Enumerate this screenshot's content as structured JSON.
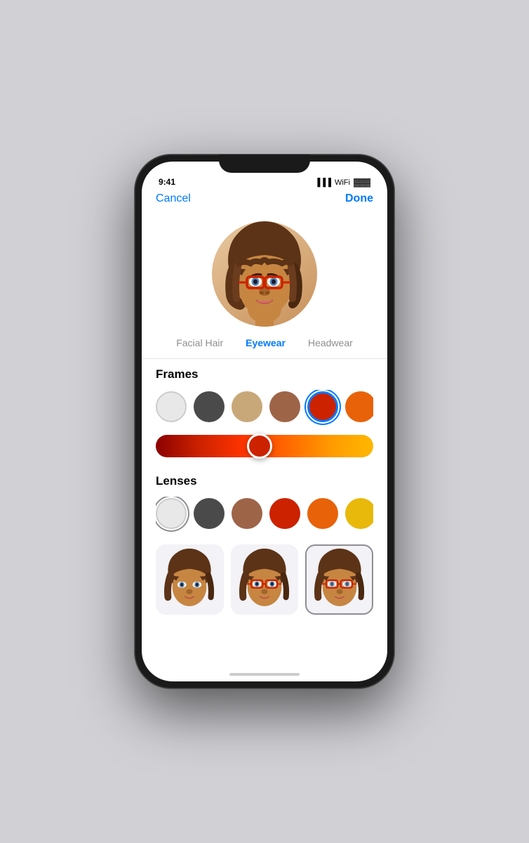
{
  "header": {
    "cancel_label": "Cancel",
    "done_label": "Done"
  },
  "tabs": [
    {
      "id": "facial-hair",
      "label": "Facial Hair",
      "active": false
    },
    {
      "id": "eyewear",
      "label": "Eyewear",
      "active": true
    },
    {
      "id": "headwear",
      "label": "Headwear",
      "active": false
    }
  ],
  "frames_section": {
    "title": "Frames",
    "colors": [
      {
        "id": "white",
        "hex": "#E8E8E8",
        "selected": false
      },
      {
        "id": "dark-gray",
        "hex": "#4A4A4A",
        "selected": false
      },
      {
        "id": "tan",
        "hex": "#C8A878",
        "selected": false
      },
      {
        "id": "brown",
        "hex": "#9E6448",
        "selected": false
      },
      {
        "id": "red",
        "hex": "#CC2200",
        "selected": true
      },
      {
        "id": "orange",
        "hex": "#E8620A",
        "selected": false
      },
      {
        "id": "yellow",
        "hex": "#E8B80A",
        "selected": false
      }
    ]
  },
  "lenses_section": {
    "title": "Lenses",
    "colors": [
      {
        "id": "clear",
        "hex": "#E8E8E8",
        "selected": true
      },
      {
        "id": "dark-gray",
        "hex": "#4A4A4A",
        "selected": false
      },
      {
        "id": "brown",
        "hex": "#9E6448",
        "selected": false
      },
      {
        "id": "red",
        "hex": "#CC2200",
        "selected": false
      },
      {
        "id": "orange",
        "hex": "#E8620A",
        "selected": false
      },
      {
        "id": "yellow",
        "hex": "#E8B80A",
        "selected": false
      },
      {
        "id": "green",
        "hex": "#5EC44A",
        "selected": false
      }
    ]
  },
  "thumbnails": [
    {
      "id": "no-glasses",
      "label": "No glasses",
      "selected": false
    },
    {
      "id": "red-glasses",
      "label": "Red glasses",
      "selected": false
    },
    {
      "id": "clear-glasses",
      "label": "Clear glasses",
      "selected": true
    }
  ]
}
